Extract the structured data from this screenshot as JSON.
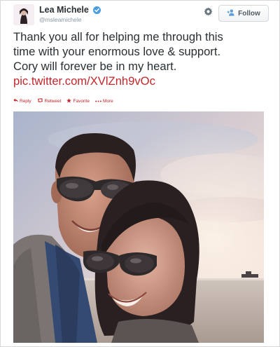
{
  "tweet": {
    "author_name": "Lea Michele",
    "author_handle": "@msleamichele",
    "follow_label": "Follow",
    "text_lines": [
      "Thank you all for helping me through this",
      "time with your enormous love & support.",
      "Cory will forever be in my heart."
    ],
    "link": "pic.twitter.com/XVlZnh9vOc",
    "actions": {
      "reply": "Reply",
      "retweet": "Retweet",
      "favorite": "Favorite",
      "more": "More"
    }
  },
  "icons": {
    "verified": "verified-badge-icon",
    "settings": "gear-icon",
    "follow": "add-user-icon",
    "reply": "reply-icon",
    "retweet": "retweet-icon",
    "favorite": "star-icon",
    "more": "ellipsis-icon"
  },
  "colors": {
    "link": "#c4262b",
    "verified": "#4a9fe0",
    "text": "#292f33",
    "handle": "#8899a6"
  }
}
